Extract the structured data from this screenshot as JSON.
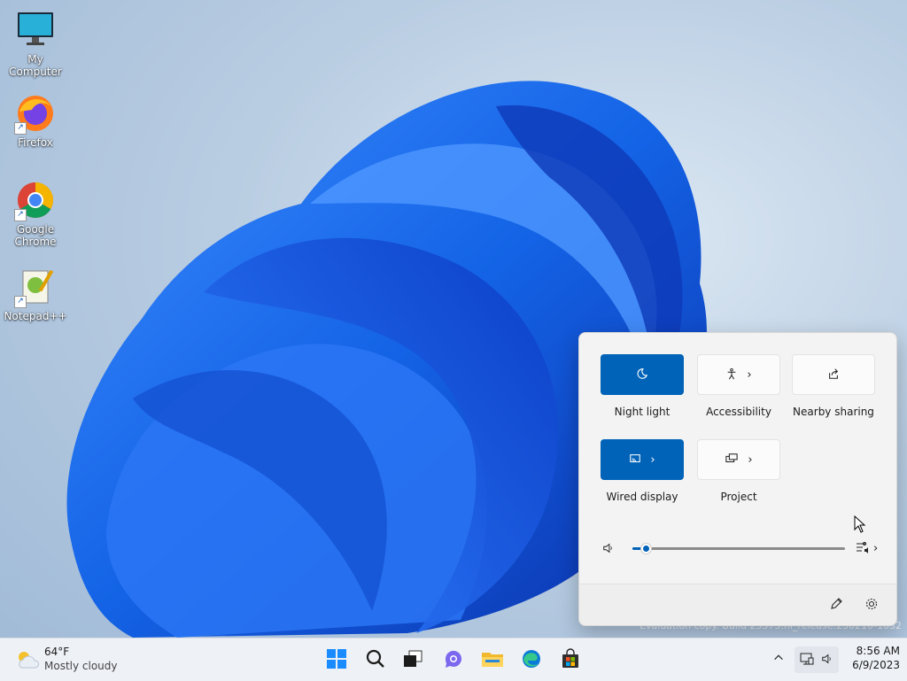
{
  "desktop": {
    "icons": [
      {
        "label": "My Computer",
        "icon": "computer-icon"
      },
      {
        "label": "Firefox",
        "icon": "firefox-icon"
      },
      {
        "label": "Google Chrome",
        "icon": "chrome-icon"
      },
      {
        "label": "Notepad++",
        "icon": "notepadpp-icon"
      }
    ],
    "watermark": "Evaluation copy. Build 23375.ni_release.230210-1032"
  },
  "quick_settings": {
    "tiles": [
      {
        "label": "Night light",
        "state": "on",
        "icon": "night-light-icon",
        "has_chevron": false
      },
      {
        "label": "Accessibility",
        "state": "off",
        "icon": "accessibility-icon",
        "has_chevron": true
      },
      {
        "label": "Nearby sharing",
        "state": "off",
        "icon": "share-icon",
        "has_chevron": false
      },
      {
        "label": "Wired display",
        "state": "on",
        "icon": "cast-icon",
        "has_chevron": true
      },
      {
        "label": "Project",
        "state": "off",
        "icon": "project-icon",
        "has_chevron": true
      }
    ],
    "volume": {
      "level": 0.02,
      "icon": "speaker-icon",
      "output_icon": "audio-output-icon"
    },
    "footer": {
      "edit_icon": "pencil-icon",
      "settings_icon": "gear-icon"
    }
  },
  "taskbar": {
    "weather": {
      "temp": "64°F",
      "condition": "Mostly cloudy",
      "icon": "cloudy-icon"
    },
    "apps": [
      "start-icon",
      "search-icon",
      "task-view-icon",
      "teams-chat-icon",
      "file-explorer-icon",
      "edge-icon",
      "store-icon"
    ],
    "tray": {
      "time": "8:56 AM",
      "date": "6/9/2023"
    }
  },
  "colors": {
    "accent": "#0063b8",
    "wallpaper_blue": "#1a5fe0"
  }
}
